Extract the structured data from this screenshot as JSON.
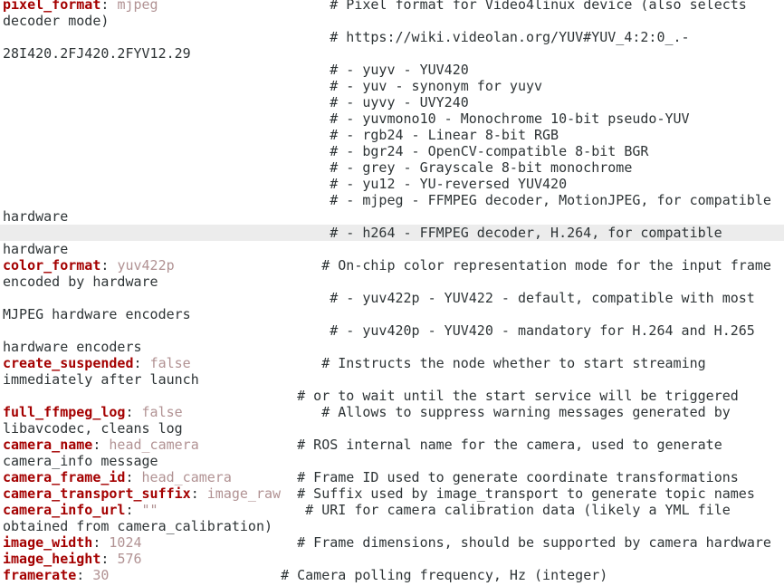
{
  "editor": {
    "lines": [
      {
        "key": "pixel_format",
        "value": "mjpeg",
        "pad": "                     ",
        "comment": "# Pixel format for Video4linux device (also selects"
      },
      {
        "text": "decoder mode)"
      },
      {
        "text": "                                        # https://wiki.videolan.org/YUV#YUV_4:2:0_.-"
      },
      {
        "text": "28I420.2FJ420.2FYV12.29"
      },
      {
        "text": "                                        # - yuyv - YUV420"
      },
      {
        "text": "                                        # - yuv - synonym for yuyv"
      },
      {
        "text": "                                        # - uyvy - UVY240"
      },
      {
        "text": "                                        # - yuvmono10 - Monochrome 10-bit pseudo-YUV"
      },
      {
        "text": "                                        # - rgb24 - Linear 8-bit RGB"
      },
      {
        "text": "                                        # - bgr24 - OpenCV-compatible 8-bit BGR"
      },
      {
        "text": "                                        # - grey - Grayscale 8-bit monochrome"
      },
      {
        "text": "                                        # - yu12 - YU-reversed YUV420"
      },
      {
        "text": "                                        # - mjpeg - FFMPEG decoder, MotionJPEG, for compatible"
      },
      {
        "text": "hardware"
      },
      {
        "text": "                                        # - h264 - FFMPEG decoder, H.264, for compatible",
        "hl": true
      },
      {
        "text": "hardware"
      },
      {
        "key": "color_format",
        "value": "yuv422p",
        "pad": "                  ",
        "comment": "# On-chip color representation mode for the input frame"
      },
      {
        "text": "encoded by hardware"
      },
      {
        "text": "                                        # - yuv422p - YUV422 - default, compatible with most"
      },
      {
        "text": "MJPEG hardware encoders"
      },
      {
        "text": "                                        # - yuv420p - YUV420 - mandatory for H.264 and H.265"
      },
      {
        "text": "hardware encoders"
      },
      {
        "key": "create_suspended",
        "value": "false",
        "pad": "                ",
        "comment": "# Instructs the node whether to start streaming"
      },
      {
        "text": "immediately after launch"
      },
      {
        "text": "                                    # or to wait until the start service will be triggered"
      },
      {
        "key": "full_ffmpeg_log",
        "value": "false",
        "pad": "                 ",
        "comment": "# Allows to suppress warning messages generated by"
      },
      {
        "text": "libavcodec, cleans log"
      },
      {
        "key": "camera_name",
        "value": "head_camera",
        "pad": "            ",
        "comment": "# ROS internal name for the camera, used to generate"
      },
      {
        "text": "camera_info message"
      },
      {
        "key": "camera_frame_id",
        "value": "head_camera",
        "pad": "        ",
        "comment": "# Frame ID used to generate coordinate transformations"
      },
      {
        "key": "camera_transport_suffix",
        "value": "image_raw",
        "pad": "  ",
        "comment": "# Suffix used by image_transport to generate topic names"
      },
      {
        "key": "camera_info_url",
        "value": "\"\"",
        "pad": "                  ",
        "comment": "# URI for camera calibration data (likely a YML file"
      },
      {
        "text": "obtained from camera_calibration)"
      },
      {
        "key": "image_width",
        "value": "1024",
        "pad": "                   ",
        "comment": "# Frame dimensions, should be supported by camera hardware"
      },
      {
        "key": "image_height",
        "value": "576",
        "pad": "                  ",
        "comment": ""
      },
      {
        "key": "framerate",
        "value": "30",
        "pad": "                     ",
        "comment": "# Camera polling frequency, Hz (integer)"
      }
    ]
  }
}
